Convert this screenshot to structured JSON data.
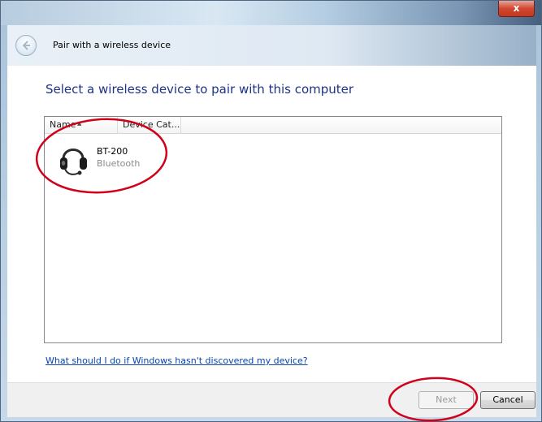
{
  "window": {
    "close_label": "x"
  },
  "header": {
    "title": "Pair with a wireless device"
  },
  "main": {
    "heading": "Select a wireless device to pair with this computer",
    "columns": [
      "Name",
      "Device Cat..."
    ],
    "devices": [
      {
        "name": "BT-200",
        "type": "Bluetooth",
        "icon": "headset-icon"
      }
    ],
    "help_link": "What should I do if Windows hasn't discovered my device?"
  },
  "footer": {
    "next_label": "Next",
    "cancel_label": "Cancel"
  },
  "colors": {
    "heading": "#1e3287",
    "link": "#0645ad",
    "annotation": "#d0021b"
  }
}
